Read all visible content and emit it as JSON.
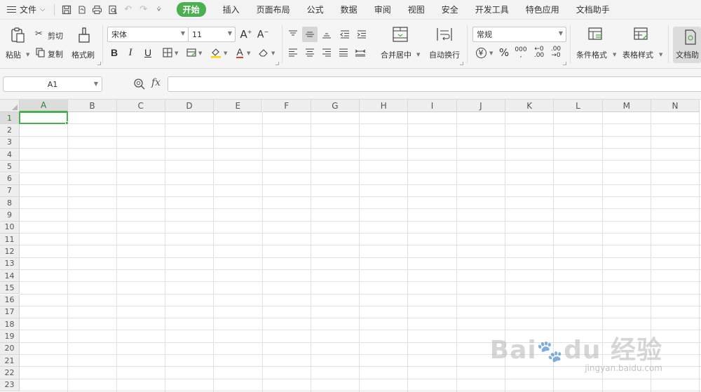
{
  "menubar": {
    "file_label": "文件",
    "tabs": [
      {
        "label": "开始",
        "active": true
      },
      {
        "label": "插入"
      },
      {
        "label": "页面布局"
      },
      {
        "label": "公式"
      },
      {
        "label": "数据"
      },
      {
        "label": "审阅"
      },
      {
        "label": "视图"
      },
      {
        "label": "安全"
      },
      {
        "label": "开发工具"
      },
      {
        "label": "特色应用"
      },
      {
        "label": "文档助手"
      }
    ]
  },
  "ribbon": {
    "paste_label": "粘贴",
    "cut_label": "剪切",
    "copy_label": "复制",
    "format_painter_label": "格式刷",
    "font_name": "宋体",
    "font_size": "11",
    "merge_center_label": "合并居中",
    "wrap_text_label": "自动换行",
    "number_format": "常规",
    "conditional_format_label": "条件格式",
    "table_style_label": "表格样式",
    "doc_helper_label": "文档助",
    "accent_color": "#4caf50",
    "font_color_underline": "#e53935",
    "fill_color_underline": "#ffd600"
  },
  "formula_bar": {
    "name_box": "A1",
    "fx_label": "fx",
    "formula": ""
  },
  "sheet": {
    "columns": [
      "A",
      "B",
      "C",
      "D",
      "E",
      "F",
      "G",
      "H",
      "I",
      "J",
      "K",
      "L",
      "M",
      "N"
    ],
    "rows": [
      "1",
      "2",
      "3",
      "4",
      "5",
      "6",
      "7",
      "8",
      "9",
      "10",
      "11",
      "12",
      "13",
      "14",
      "15",
      "16",
      "17",
      "18",
      "19",
      "20",
      "21",
      "22",
      "23"
    ],
    "active_cell": "A1"
  },
  "watermark": {
    "text": "Bai du 经验",
    "sub": "jingyan.baidu.com"
  }
}
